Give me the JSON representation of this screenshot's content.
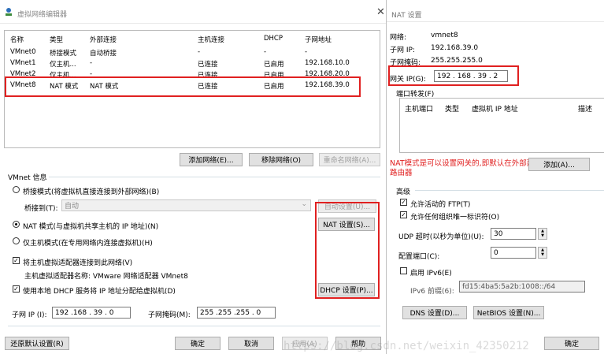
{
  "main": {
    "title": "虚拟网络编辑器",
    "columns": [
      "名称",
      "类型",
      "外部连接",
      "主机连接",
      "DHCP",
      "子网地址"
    ],
    "rows": [
      {
        "name": "VMnet0",
        "type": "桥接模式",
        "ext": "自动桥接",
        "host": "-",
        "dhcp": "-",
        "subnet": "-"
      },
      {
        "name": "VMnet1",
        "type": "仅主机...",
        "ext": "-",
        "host": "已连接",
        "dhcp": "已启用",
        "subnet": "192.168.10.0"
      },
      {
        "name": "VMnet2",
        "type": "仅主机...",
        "ext": "-",
        "host": "已连接",
        "dhcp": "已启用",
        "subnet": "192.168.20.0"
      },
      {
        "name": "VMnet8",
        "type": "NAT 模式",
        "ext": "NAT 模式",
        "host": "已连接",
        "dhcp": "已启用",
        "subnet": "192.168.39.0"
      }
    ],
    "add_network": "添加网络(E)...",
    "remove_network": "移除网络(O)",
    "rename_network": "重命名网络(A)...",
    "vmnet_info": "VMnet 信息",
    "bridge_mode": "桥接模式(将虚拟机直接连接到外部网络)(B)",
    "bridge_to_label": "桥接到(T):",
    "bridge_to_value": "自动",
    "auto_settings": "自动设置(U)...",
    "nat_mode": "NAT 模式(与虚拟机共享主机的 IP 地址)(N)",
    "nat_settings": "NAT 设置(S)...",
    "host_only": "仅主机模式(在专用网络内连接虚拟机)(H)",
    "connect_adapter": "将主机虚拟适配器连接到此网络(V)",
    "adapter_name": "主机虚拟适配器名称: VMware 网络适配器 VMnet8",
    "use_dhcp": "使用本地 DHCP 服务将 IP 地址分配给虚拟机(D)",
    "dhcp_settings": "DHCP 设置(P)...",
    "subnet_ip_label": "子网 IP (I):",
    "subnet_ip": "192 .168 . 39 . 0",
    "subnet_mask_label": "子网掩码(M):",
    "subnet_mask": "255 .255 .255 . 0",
    "restore_defaults": "还原默认设置(R)",
    "ok": "确定",
    "cancel": "取消",
    "apply": "应用(A)",
    "help": "帮助"
  },
  "nat": {
    "title": "NAT 设置",
    "network_label": "网络:",
    "network_value": "vmnet8",
    "subnet_ip_label": "子网 IP:",
    "subnet_ip_value": "192.168.39.0",
    "subnet_mask_label": "子网掩码:",
    "subnet_mask_value": "255.255.255.0",
    "gateway_label": "网关 IP(G):",
    "gateway_value": "192 . 168 . 39 . 2",
    "port_forward": "端口转发(F)",
    "pf_columns": [
      "主机端口",
      "类型",
      "虚拟机 IP 地址",
      "描述"
    ],
    "annotation_line1": "NAT模式是可以设置网关的,即默认在外部建的",
    "annotation_line2": "路由器",
    "add_button": "添加(A)...",
    "advanced": "高级",
    "allow_ftp": "允许活动的 FTP(T)",
    "allow_oui": "允许任何组织唯一标识符(O)",
    "udp_timeout_label": "UDP 超时(以秒为单位)(U):",
    "udp_timeout_value": "30",
    "config_port_label": "配置端口(C):",
    "config_port_value": "0",
    "enable_ipv6": "启用 IPv6(E)",
    "ipv6_prefix_label": "IPv6 前缀(6):",
    "ipv6_prefix_value": "fd15:4ba5:5a2b:1008::/64",
    "dns_settings": "DNS 设置(D)...",
    "netbios_settings": "NetBIOS 设置(N)...",
    "ok": "确定"
  },
  "watermark": "https://blog.csdn.net/weixin_42350212",
  "colors": {
    "highlight_box": "#e02020",
    "annotation_text": "#e02020",
    "window_bg": "#ffffff"
  }
}
